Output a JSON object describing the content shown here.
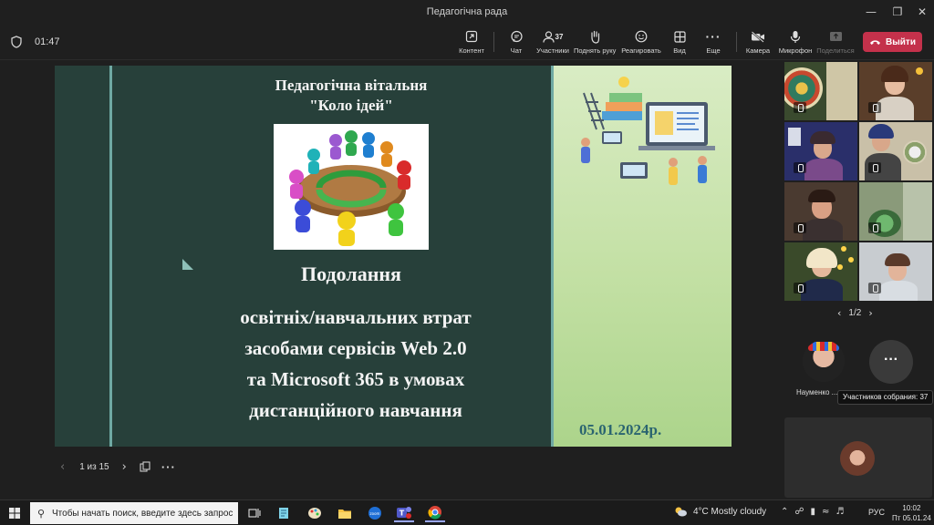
{
  "window": {
    "title": "Педагогічна рада"
  },
  "toolbar": {
    "timer": "01:47",
    "buttons": {
      "content": "Контент",
      "chat": "Чат",
      "participants": "Участники",
      "participants_count": "37",
      "raise_hand": "Поднять руку",
      "react": "Реагировать",
      "view": "Вид",
      "more": "Еще",
      "camera": "Камера",
      "mic": "Микрофон",
      "share": "Поделиться"
    },
    "leave_label": "Выйти"
  },
  "slide": {
    "line1": "Педагогічна вітальня",
    "line2": "\"Коло ідей\"",
    "heading": "Подолання",
    "body": [
      "освітніх/навчальних  втрат",
      "засобами сервісів Web 2.0",
      "та Microsoft 365 в умовах",
      "дистанційного навчання"
    ],
    "date": "05.01.2024р.",
    "colors": {
      "left_bg": "#27403a",
      "right_bg": "#c3e0a4",
      "date": "#2a6470",
      "accent_line": "#6fa9a3"
    }
  },
  "slide_nav": {
    "page": "1 из 15"
  },
  "gallery": {
    "page": "1/2",
    "extra_participant_name": "Науменко ...",
    "tooltip": "Участников собрания: 37"
  },
  "taskbar": {
    "search_placeholder": "Чтобы начать поиск, введите здесь запрос",
    "weather": "4°C  Mostly cloudy",
    "lang": "РУС",
    "time": "10:02",
    "date": "Пт 05.01.24"
  },
  "accent_colors": {
    "leave": "#c4314b",
    "background": "#1f1f1f"
  }
}
